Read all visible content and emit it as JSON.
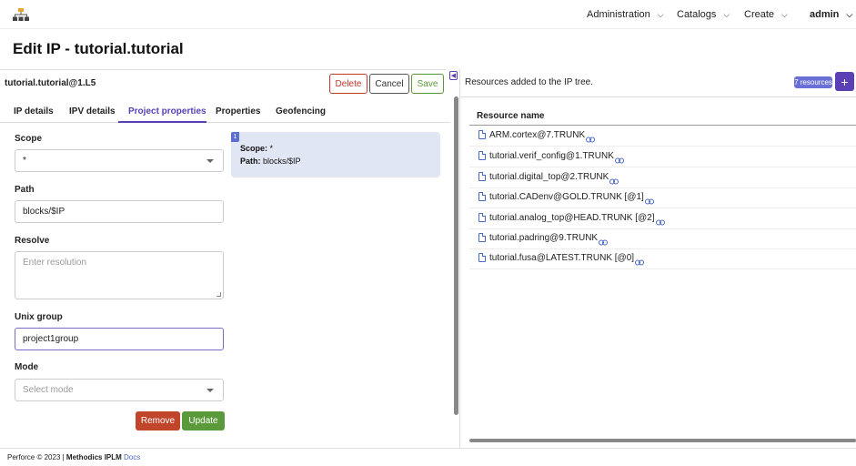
{
  "nav": {
    "items": [
      {
        "label": "Administration"
      },
      {
        "label": "Catalogs"
      },
      {
        "label": "Create"
      },
      {
        "label": "admin"
      }
    ]
  },
  "page": {
    "title": "Edit IP - tutorial.tutorial"
  },
  "left": {
    "ip_name": "tutorial.tutorial@1.L5",
    "buttons": {
      "delete": "Delete",
      "cancel": "Cancel",
      "save": "Save"
    },
    "tabs": [
      {
        "label": "IP details"
      },
      {
        "label": "IPV details"
      },
      {
        "label": "Project properties"
      },
      {
        "label": "Properties"
      },
      {
        "label": "Geofencing"
      }
    ],
    "form": {
      "scope_label": "Scope",
      "scope_value": "*",
      "path_label": "Path",
      "path_value": "blocks/$IP",
      "resolve_label": "Resolve",
      "resolve_placeholder": "Enter resolution",
      "unix_group_label": "Unix group",
      "unix_group_value": "project1group",
      "mode_label": "Mode",
      "mode_placeholder": "Select mode",
      "remove": "Remove",
      "update": "Update"
    },
    "scope_card": {
      "index": "1",
      "scope_key": "Scope:",
      "scope_val": "*",
      "path_key": "Path:",
      "path_val": "blocks/$IP"
    }
  },
  "right": {
    "header": "Resources added to the IP tree.",
    "badge": "7 resources",
    "add": "+",
    "column": "Resource name",
    "resources": [
      {
        "name": "ARM.cortex@7.TRUNK"
      },
      {
        "name": "tutorial.verif_config@1.TRUNK"
      },
      {
        "name": "tutorial.digital_top@2.TRUNK"
      },
      {
        "name": "tutorial.CADenv@GOLD.TRUNK [@1]"
      },
      {
        "name": "tutorial.analog_top@HEAD.TRUNK [@2]"
      },
      {
        "name": "tutorial.padring@9.TRUNK"
      },
      {
        "name": "tutorial.fusa@LATEST.TRUNK [@0]"
      }
    ]
  },
  "footer": {
    "copyright": "Perforce © 2023 |",
    "brand": "Methodics IPLM",
    "docs": "Docs"
  }
}
